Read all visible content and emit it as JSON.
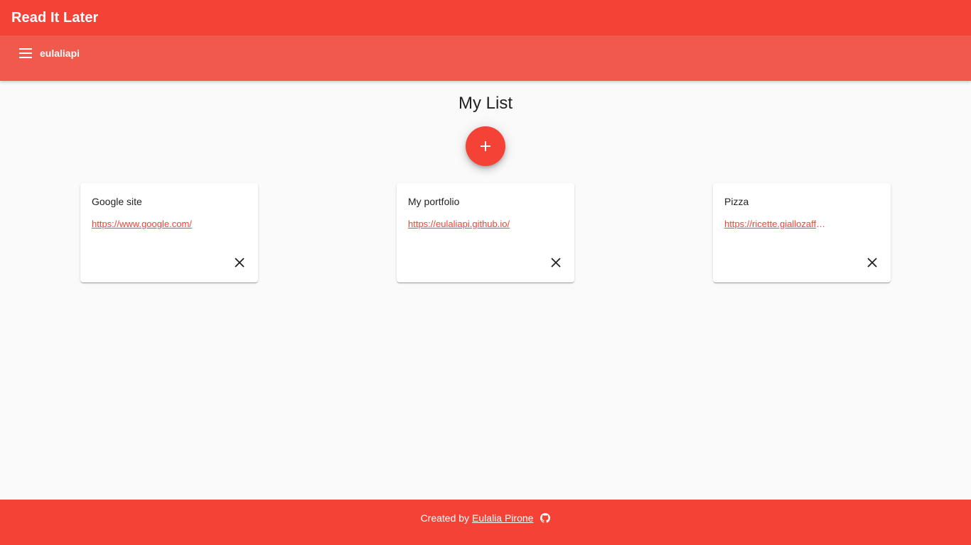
{
  "app": {
    "title": "Read It Later"
  },
  "user_bar": {
    "menu_icon": "menu-icon",
    "username": "eulaliapi"
  },
  "main": {
    "title": "My List",
    "add_icon": "plus-icon",
    "cards": [
      {
        "title": "Google site",
        "link": "https://www.google.com/",
        "close_icon": "close-icon"
      },
      {
        "title": "My portfolio",
        "link": "https://eulaliapi.github.io/",
        "close_icon": "close-icon"
      },
      {
        "title": "Pizza",
        "link": "https://ricette.giallozafferano.it/",
        "close_icon": "close-icon"
      }
    ]
  },
  "footer": {
    "prefix": "Created by",
    "author": "Eulalia Pirone",
    "icon": "github-icon"
  },
  "colors": {
    "primary": "#f44336",
    "secondary_bar": "#ef5a4d",
    "background": "#fafafa",
    "card": "#ffffff"
  }
}
